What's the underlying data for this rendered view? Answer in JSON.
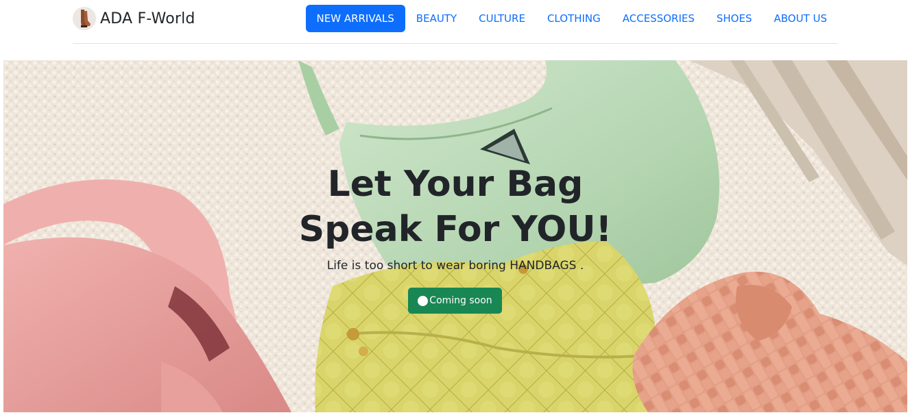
{
  "header": {
    "brand": {
      "name": "ADA F-World",
      "logo_icon": "boots-icon"
    },
    "nav": [
      {
        "label": "NEW ARRIVALS",
        "active": true
      },
      {
        "label": "BEAUTY",
        "active": false
      },
      {
        "label": "CULTURE",
        "active": false
      },
      {
        "label": "CLOTHING",
        "active": false
      },
      {
        "label": "ACCESSORIES",
        "active": false
      },
      {
        "label": "SHOES",
        "active": false
      },
      {
        "label": "ABOUT US",
        "active": false
      }
    ]
  },
  "hero": {
    "background_image": "handbags-photo",
    "title_line1": "Let Your Bag",
    "title_line2": "Speak For YOU!",
    "subtitle": "Life is too short to wear boring HANDBAGS .",
    "button": {
      "label": "Coming soon",
      "icon": "spinner-icon"
    }
  },
  "colors": {
    "primary": "#0d6efd",
    "success": "#198754",
    "text": "#212529",
    "divider": "#dee2e6"
  }
}
